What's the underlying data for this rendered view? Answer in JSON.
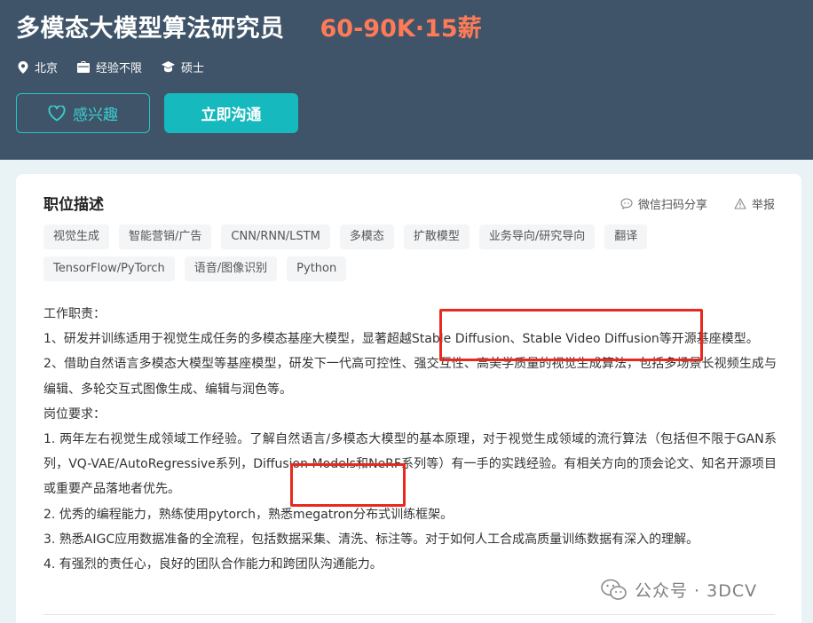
{
  "job": {
    "title": "多模态大模型算法研究员",
    "salary": "60-90K·15薪",
    "location": "北京",
    "experience": "经验不限",
    "degree": "硕士"
  },
  "buttons": {
    "interest_label": "感兴趣",
    "chat_label": "立即沟通"
  },
  "section": {
    "title": "职位描述",
    "share_label": "微信扫码分享",
    "report_label": "举报"
  },
  "tags": [
    "视觉生成",
    "智能营销/广告",
    "CNN/RNN/LSTM",
    "多模态",
    "扩散模型",
    "业务导向/研究导向",
    "翻译",
    "TensorFlow/PyTorch",
    "语音/图像识别",
    "Python"
  ],
  "description": {
    "duties_heading": "工作职责：",
    "duty_1": "1、研发并训练适用于视觉生成任务的多模态基座大模型，显著超越Stable Diffusion、Stable Video Diffusion等开源基座模型。",
    "duty_2": "2、借助自然语言多模态大模型等基座模型，研发下一代高可控性、强交互性、高美学质量的视觉生成算法，包括多场景长视频生成与编辑、多轮交互式图像生成、编辑与润色等。",
    "requirements_heading": "岗位要求：",
    "req_1": "1. 两年左右视觉生成领域工作经验。了解自然语言/多模态大模型的基本原理，对于视觉生成领域的流行算法（包括但不限于GAN系列，VQ-VAE/AutoRegressive系列，Diffusion Models和NeRF系列等）有一手的实践经验。有相关方向的顶会论文、知名开源项目或重要产品落地者优先。",
    "req_2": "2. 优秀的编程能力，熟练使用pytorch，熟悉megatron分布式训练框架。",
    "req_3": "3. 熟悉AIGC应用数据准备的全流程，包括数据采集、清洗、标注等。对于如何人工合成高质量训练数据有深入的理解。",
    "req_4": "4. 有强烈的责任心，良好的团队合作能力和跨团队沟通能力。"
  },
  "watermark": "公众号 · 3DCV",
  "colors": {
    "header_bg": "#3f5469",
    "salary": "#ff7b58",
    "accent": "#16b9bd",
    "highlight": "#e8291e"
  }
}
